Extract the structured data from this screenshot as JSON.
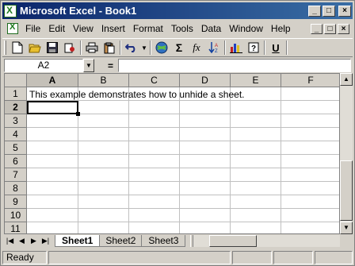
{
  "window": {
    "title": "Microsoft Excel - Book1"
  },
  "title_buttons": {
    "minimize": "_",
    "maximize": "□",
    "close": "×"
  },
  "menu": {
    "items": [
      "File",
      "Edit",
      "View",
      "Insert",
      "Format",
      "Tools",
      "Data",
      "Window",
      "Help"
    ],
    "doc_buttons": {
      "minimize": "_",
      "restore": "□",
      "close": "×"
    }
  },
  "toolbar": {
    "icons": [
      "new-icon",
      "open-icon",
      "save-icon",
      "permission-icon",
      "print-icon",
      "paste-icon",
      "undo-icon",
      "hyperlink-icon",
      "autosum-icon",
      "function-icon",
      "sort-icon",
      "chart-icon",
      "help-icon",
      "underline-icon"
    ],
    "autosum": "Σ",
    "function": "fx",
    "underline": "U"
  },
  "formula_bar": {
    "name_box": "A2",
    "equals": "=",
    "content": ""
  },
  "grid": {
    "columns": [
      "A",
      "B",
      "C",
      "D",
      "E",
      "F"
    ],
    "rows": [
      "1",
      "2",
      "3",
      "4",
      "5",
      "6",
      "7",
      "8",
      "9",
      "10",
      "11"
    ],
    "active_column": "A",
    "active_row": "2",
    "cells": {
      "A1": "This example demonstrates how to unhide a sheet."
    }
  },
  "sheets": {
    "tabs": [
      "Sheet1",
      "Sheet2",
      "Sheet3"
    ],
    "active": "Sheet1"
  },
  "status": {
    "text": "Ready"
  },
  "colors": {
    "title_start": "#0a246a",
    "title_end": "#3a6ea5",
    "chrome": "#d4d0c8"
  }
}
